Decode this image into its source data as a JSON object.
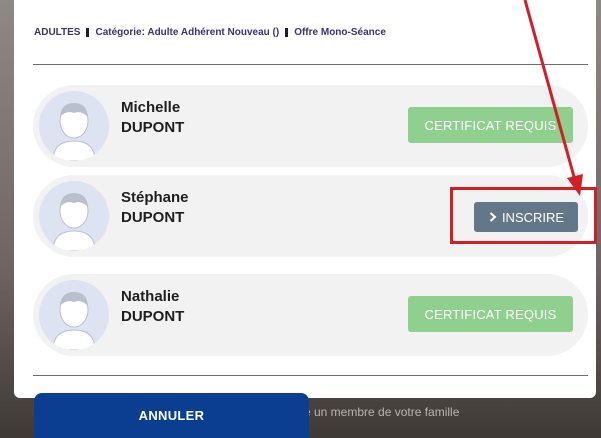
{
  "breadcrumb": {
    "group": "ADULTES",
    "category": "Catégorie: Adulte Adhérent Nouveau ()",
    "offer": "Offre Mono-Séance"
  },
  "members": [
    {
      "first_name": "Michelle",
      "last_name": "DUPONT",
      "action_label": "CERTIFICAT REQUIS",
      "action_type": "certificate-required"
    },
    {
      "first_name": "Stéphane",
      "last_name": "DUPONT",
      "action_label": "INSCRIRE",
      "action_type": "register"
    },
    {
      "first_name": "Nathalie",
      "last_name": "DUPONT",
      "action_label": "CERTIFICAT REQUIS",
      "action_type": "certificate-required"
    }
  ],
  "footer": {
    "cancel_label": "ANNULER"
  },
  "background": {
    "partial_text": "re un membre de votre famille"
  },
  "colors": {
    "certificate_button": "#8fd08f",
    "register_button": "#647788",
    "cancel_button": "#0b3d91",
    "highlight": "#d21f26",
    "breadcrumb_text": "#3b3270"
  },
  "icons": {
    "avatar": "avatar-placeholder-icon",
    "register": "chevron-right-icon"
  }
}
